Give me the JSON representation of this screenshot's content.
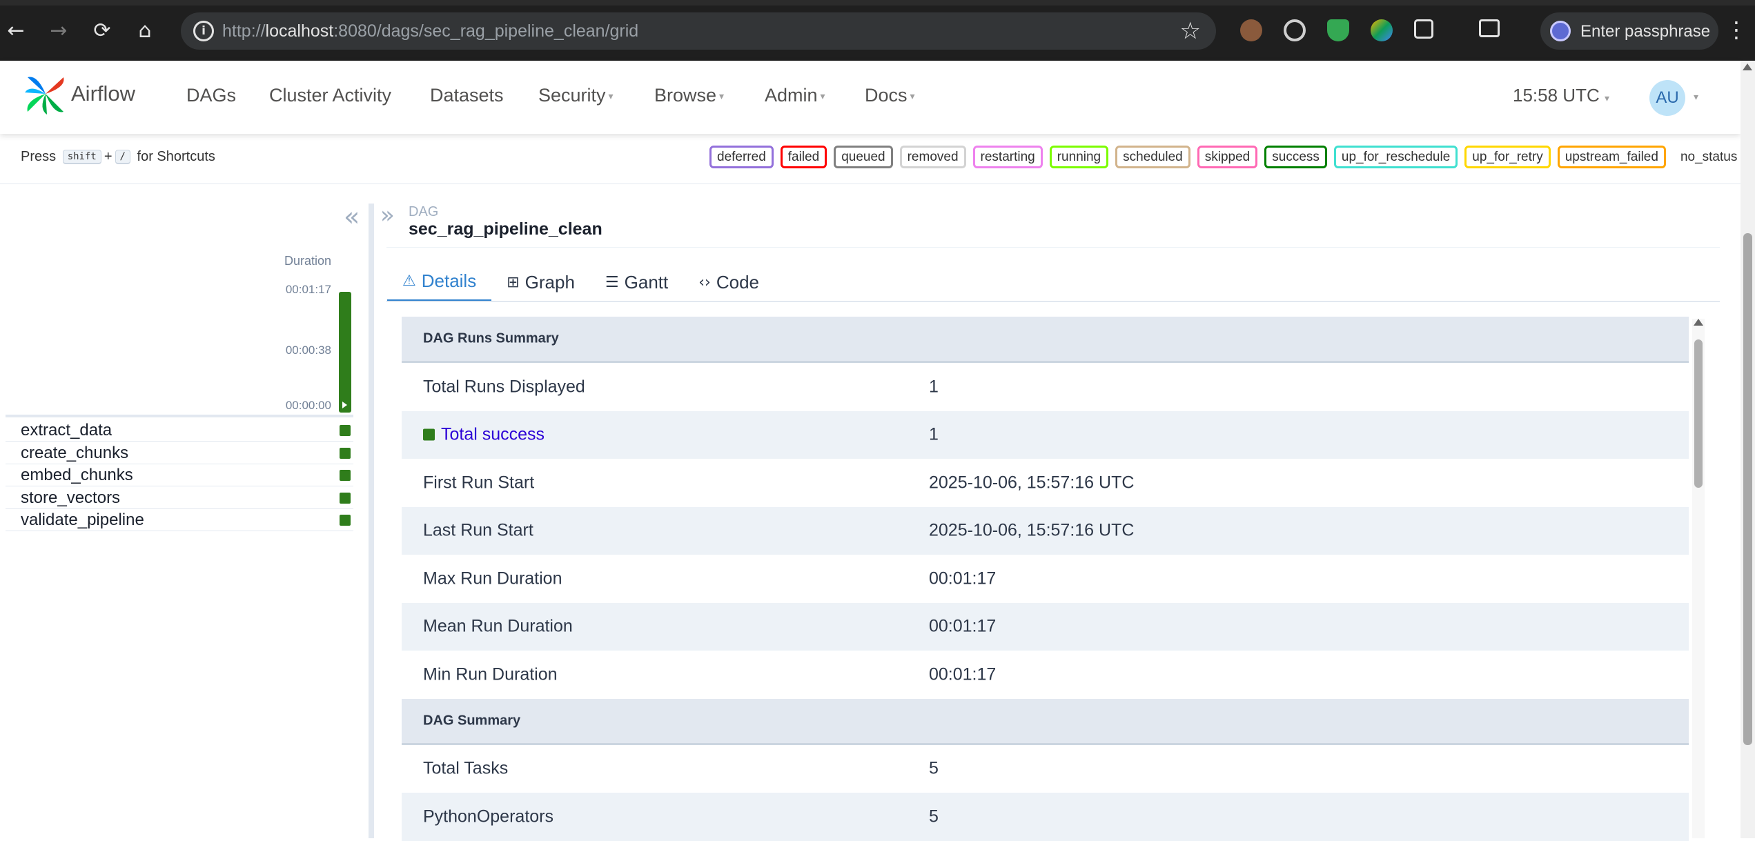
{
  "browser": {
    "url_prefix": "http://",
    "url_host": "localhost",
    "url_rest": ":8080/dags/sec_rag_pipeline_clean/grid",
    "profile_label": "Enter passphrase"
  },
  "nav": {
    "brand": "Airflow",
    "items": [
      {
        "label": "DAGs"
      },
      {
        "label": "Cluster Activity"
      },
      {
        "label": "Datasets"
      },
      {
        "label": "Security"
      },
      {
        "label": "Browse"
      },
      {
        "label": "Admin"
      },
      {
        "label": "Docs"
      }
    ],
    "clock": "15:58 UTC",
    "avatar": "AU"
  },
  "shortcuts": {
    "press": "Press",
    "key1": "shift",
    "plus": "+",
    "key2": "/",
    "suffix": "for Shortcuts"
  },
  "legend": [
    {
      "label": "deferred",
      "color": "#9370db"
    },
    {
      "label": "failed",
      "color": "#ff0000"
    },
    {
      "label": "queued",
      "color": "#808080"
    },
    {
      "label": "removed",
      "color": "#d3d3d3"
    },
    {
      "label": "restarting",
      "color": "#ee82ee"
    },
    {
      "label": "running",
      "color": "#7cfc00"
    },
    {
      "label": "scheduled",
      "color": "#d2b48c"
    },
    {
      "label": "skipped",
      "color": "#ff69b4"
    },
    {
      "label": "success",
      "color": "#008000"
    },
    {
      "label": "up_for_reschedule",
      "color": "#40e0d0"
    },
    {
      "label": "up_for_retry",
      "color": "#ffd700"
    },
    {
      "label": "upstream_failed",
      "color": "#ffa500"
    },
    {
      "label": "no_status",
      "color": "transparent"
    }
  ],
  "grid": {
    "duration_label": "Duration",
    "ticks": [
      "00:01:17",
      "00:00:38",
      "00:00:00"
    ],
    "run_state_color": "#2f7d1b",
    "tasks": [
      {
        "name": "extract_data",
        "state": "success"
      },
      {
        "name": "create_chunks",
        "state": "success"
      },
      {
        "name": "embed_chunks",
        "state": "success"
      },
      {
        "name": "store_vectors",
        "state": "success"
      },
      {
        "name": "validate_pipeline",
        "state": "success"
      }
    ]
  },
  "details": {
    "breadcrumb_label": "DAG",
    "dag_id": "sec_rag_pipeline_clean",
    "tabs": [
      {
        "label": "Details",
        "icon": "warning-triangle-icon"
      },
      {
        "label": "Graph",
        "icon": "graph-icon"
      },
      {
        "label": "Gantt",
        "icon": "gantt-icon"
      },
      {
        "label": "Code",
        "icon": "code-icon"
      }
    ],
    "rows": [
      {
        "type": "section",
        "key": "DAG Runs Summary",
        "value": ""
      },
      {
        "type": "row",
        "key": "Total Runs Displayed",
        "value": "1"
      },
      {
        "type": "row",
        "key": "Total success",
        "value": "1",
        "link": true
      },
      {
        "type": "row",
        "key": "First Run Start",
        "value": "2025-10-06, 15:57:16 UTC"
      },
      {
        "type": "row",
        "key": "Last Run Start",
        "value": "2025-10-06, 15:57:16 UTC"
      },
      {
        "type": "row",
        "key": "Max Run Duration",
        "value": "00:01:17"
      },
      {
        "type": "row",
        "key": "Mean Run Duration",
        "value": "00:01:17"
      },
      {
        "type": "row",
        "key": "Min Run Duration",
        "value": "00:01:17"
      },
      {
        "type": "section",
        "key": "DAG Summary",
        "value": ""
      },
      {
        "type": "row",
        "key": "Total Tasks",
        "value": "5"
      },
      {
        "type": "row",
        "key": "PythonOperators",
        "value": "5"
      }
    ]
  }
}
